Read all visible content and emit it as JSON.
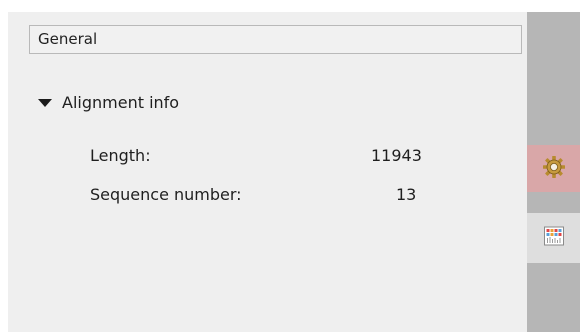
{
  "panel": {
    "group_title": "General",
    "section": {
      "title": "Alignment info",
      "expanded": true,
      "rows": [
        {
          "label": "Length:",
          "value": "11943"
        },
        {
          "label": "Sequence number:",
          "value": "13"
        }
      ]
    }
  },
  "side_tabs": [
    {
      "name": "general-settings",
      "icon": "gear-icon",
      "active": true
    },
    {
      "name": "overview",
      "icon": "alignment-overview-icon",
      "active": false
    }
  ],
  "colors": {
    "panel_bg": "#efefef",
    "strip_bg": "#b6b6b6",
    "active_tab_bg": "#d9a7a8"
  }
}
